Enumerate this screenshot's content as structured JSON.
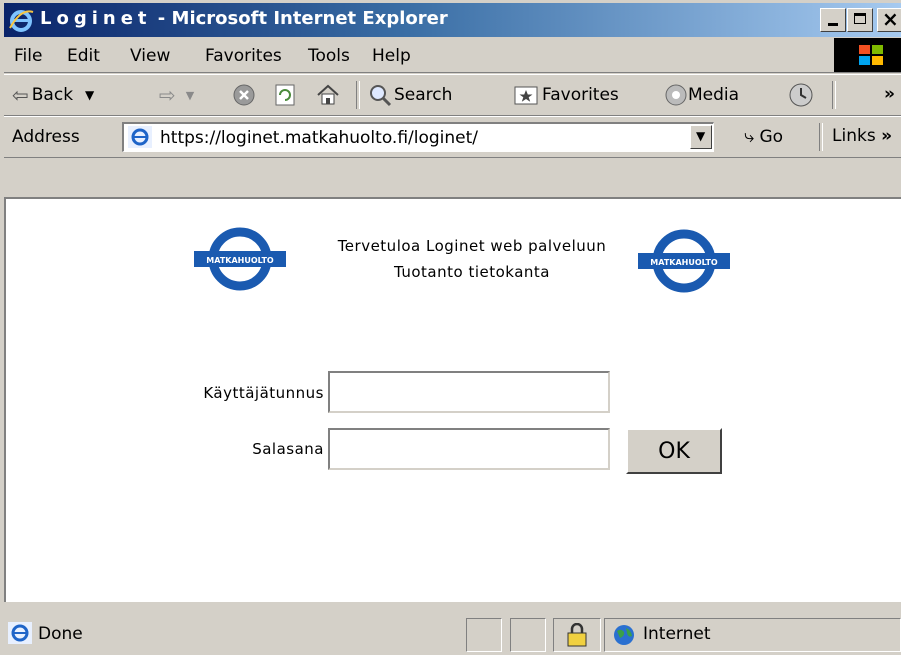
{
  "window": {
    "title_app": "Loginet",
    "title_suffix": " - Microsoft Internet Explorer"
  },
  "menu": [
    "File",
    "Edit",
    "View",
    "Favorites",
    "Tools",
    "Help"
  ],
  "toolbar": {
    "back": "Back",
    "search": "Search",
    "favorites": "Favorites",
    "media": "Media",
    "more": "»"
  },
  "address": {
    "label": "Address",
    "url": "https://loginet.matkahuolto.fi/loginet/",
    "go": "Go",
    "links": "Links",
    "links_more": "»"
  },
  "page": {
    "welcome_line1": "Tervetuloa Loginet web palveluun",
    "welcome_line2": "Tuotanto tietokanta",
    "logo_text": "MATKAHUOLTO",
    "username_label": "Käyttäjätunnus",
    "username_value": "",
    "password_label": "Salasana",
    "password_value": "",
    "ok_button": "OK"
  },
  "status": {
    "text": "Done",
    "zone": "Internet"
  },
  "colors": {
    "titlebar_start": "#0a246a",
    "titlebar_end": "#a6caf0",
    "logo_blue": "#1a5ab0",
    "chrome": "#d4d0c8"
  }
}
